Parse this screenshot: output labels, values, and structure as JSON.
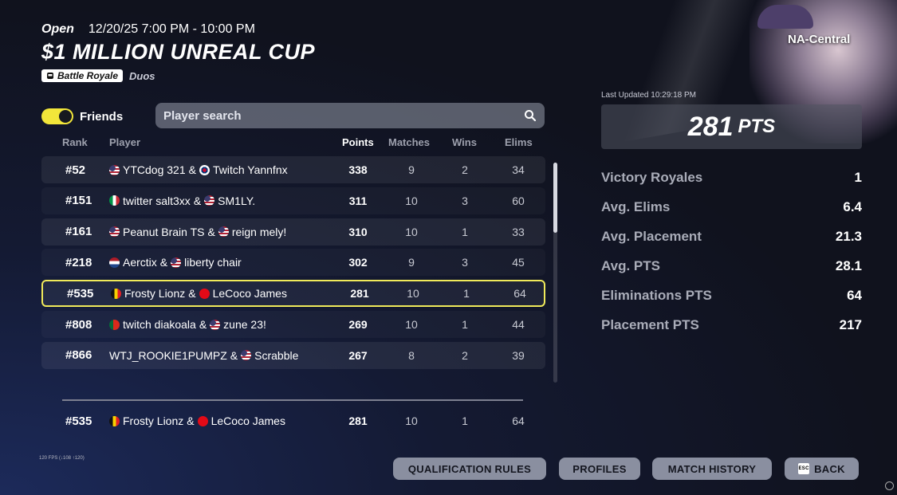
{
  "header": {
    "status": "Open",
    "datetime": "12/20/25 7:00 PM - 10:00 PM",
    "title": "$1 MILLION UNREAL CUP",
    "mode_tag": "Battle Royale",
    "team_type": "Duos"
  },
  "region": "NA-Central",
  "friends_toggle": {
    "label": "Friends",
    "on": true
  },
  "search": {
    "placeholder": "Player search"
  },
  "leaderboard": {
    "columns": [
      "Rank",
      "Player",
      "Points",
      "Matches",
      "Wins",
      "Elims"
    ],
    "rows": [
      {
        "rank": "#52",
        "p1": "YTCdog 321",
        "p2": "Twitch Yannfnx",
        "points": "338",
        "matches": "9",
        "wins": "2",
        "elims": "34"
      },
      {
        "rank": "#151",
        "p1": "twitter salt3xx",
        "p2": "SM1LY.",
        "points": "311",
        "matches": "10",
        "wins": "3",
        "elims": "60"
      },
      {
        "rank": "#161",
        "p1": "Peanut Brain TS",
        "p2": "reign mely!",
        "points": "310",
        "matches": "10",
        "wins": "1",
        "elims": "33"
      },
      {
        "rank": "#218",
        "p1": "Aerctix",
        "p2": "liberty chair",
        "points": "302",
        "matches": "9",
        "wins": "3",
        "elims": "45"
      },
      {
        "rank": "#535",
        "p1": "Frosty Lionz",
        "p2": "LeCoco James",
        "points": "281",
        "matches": "10",
        "wins": "1",
        "elims": "64"
      },
      {
        "rank": "#808",
        "p1": "twitch diakoala",
        "p2": "zune 23!",
        "points": "269",
        "matches": "10",
        "wins": "1",
        "elims": "44"
      },
      {
        "rank": "#866",
        "p1": "WTJ_ROOKIE1PUMPZ",
        "p2": "Scrabble",
        "points": "267",
        "matches": "8",
        "wins": "2",
        "elims": "39"
      }
    ],
    "my_row": {
      "rank": "#535",
      "p1": "Frosty Lionz",
      "p2": "LeCoco James",
      "points": "281",
      "matches": "10",
      "wins": "1",
      "elims": "64"
    },
    "separator": "&"
  },
  "stats": {
    "last_updated": "Last Updated 10:29:18 PM",
    "total_points": "281",
    "points_unit": "PTS",
    "items": [
      {
        "label": "Victory Royales",
        "value": "1"
      },
      {
        "label": "Avg. Elims",
        "value": "6.4"
      },
      {
        "label": "Avg. Placement",
        "value": "21.3"
      },
      {
        "label": "Avg. PTS",
        "value": "28.1"
      },
      {
        "label": "Eliminations PTS",
        "value": "64"
      },
      {
        "label": "Placement PTS",
        "value": "217"
      }
    ]
  },
  "footer": {
    "fps": "120 FPS (↓108 ↑120)",
    "buttons": {
      "qualification_rules": "QUALIFICATION RULES",
      "profiles": "PROFILES",
      "match_history": "MATCH HISTORY",
      "back": "BACK",
      "esc": "ESC"
    }
  },
  "colors": {
    "highlight": "#f0ea5a",
    "toggle_on": "#f2e63a"
  }
}
